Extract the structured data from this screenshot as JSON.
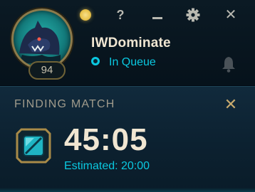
{
  "profile": {
    "username": "IWDominate",
    "level": "94",
    "status": "In Queue",
    "avatar_icon": "werewolf-portrait-icon"
  },
  "controls": {
    "help_label": "?",
    "close_label": "✕"
  },
  "queue": {
    "title": "FINDING MATCH",
    "timer": "45:05",
    "estimated": "Estimated: 20:00",
    "dismiss_label": "✕"
  },
  "colors": {
    "accent_cyan": "#0ac8e0",
    "gold": "#c8aa6e",
    "text_light": "#f0e6d2",
    "background": "#010a13"
  }
}
